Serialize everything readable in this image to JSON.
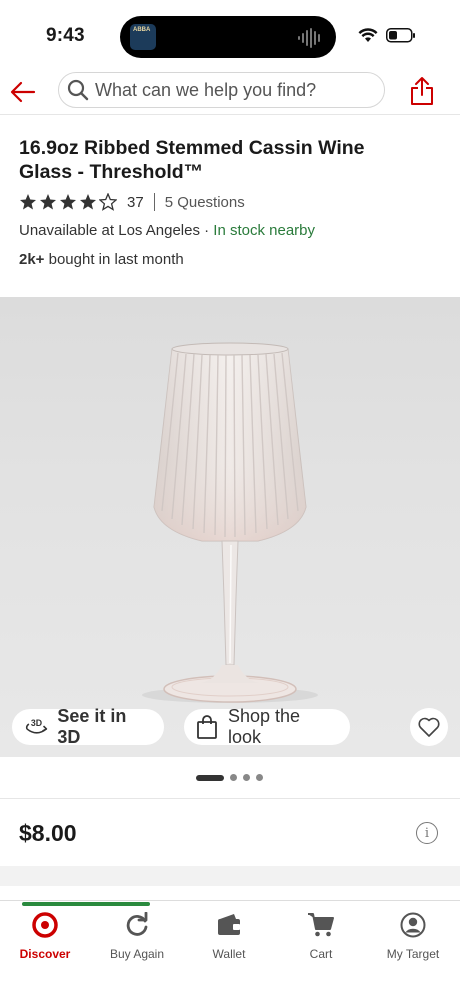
{
  "status_bar": {
    "time": "9:43",
    "now_playing_label": "ABBA",
    "icons": [
      "wifi-icon",
      "battery-icon"
    ]
  },
  "header": {
    "back_icon": "arrow-left-icon",
    "search": {
      "placeholder": "What can we help you find?",
      "value": ""
    },
    "share_icon": "share-icon"
  },
  "product": {
    "title": "16.9oz Ribbed Stemmed Cassin Wine Glass - Threshold™",
    "rating": 4,
    "rating_max": 5,
    "review_count": "37",
    "questions": "5 Questions",
    "availability_prefix": "Unavailable at Los Angeles · ",
    "availability_status": "In stock nearby",
    "bought_count": "2k+",
    "bought_suffix": " bought in last month",
    "price": "$8.00"
  },
  "image": {
    "see_3d_label": "See it in 3D",
    "shop_look_label": "Shop the look",
    "carousel": {
      "total": 4,
      "active": 0
    }
  },
  "bottom_nav": {
    "items": [
      {
        "label": "Discover",
        "icon": "target-bullseye-icon",
        "active": true
      },
      {
        "label": "Buy Again",
        "icon": "refresh-icon",
        "active": false
      },
      {
        "label": "Wallet",
        "icon": "wallet-icon",
        "active": false
      },
      {
        "label": "Cart",
        "icon": "cart-icon",
        "active": false
      },
      {
        "label": "My Target",
        "icon": "user-icon",
        "active": false
      }
    ]
  },
  "colors": {
    "brand_red": "#cc0000",
    "in_stock_green": "#2a7b3b",
    "text_dark": "#1a1a1a"
  }
}
